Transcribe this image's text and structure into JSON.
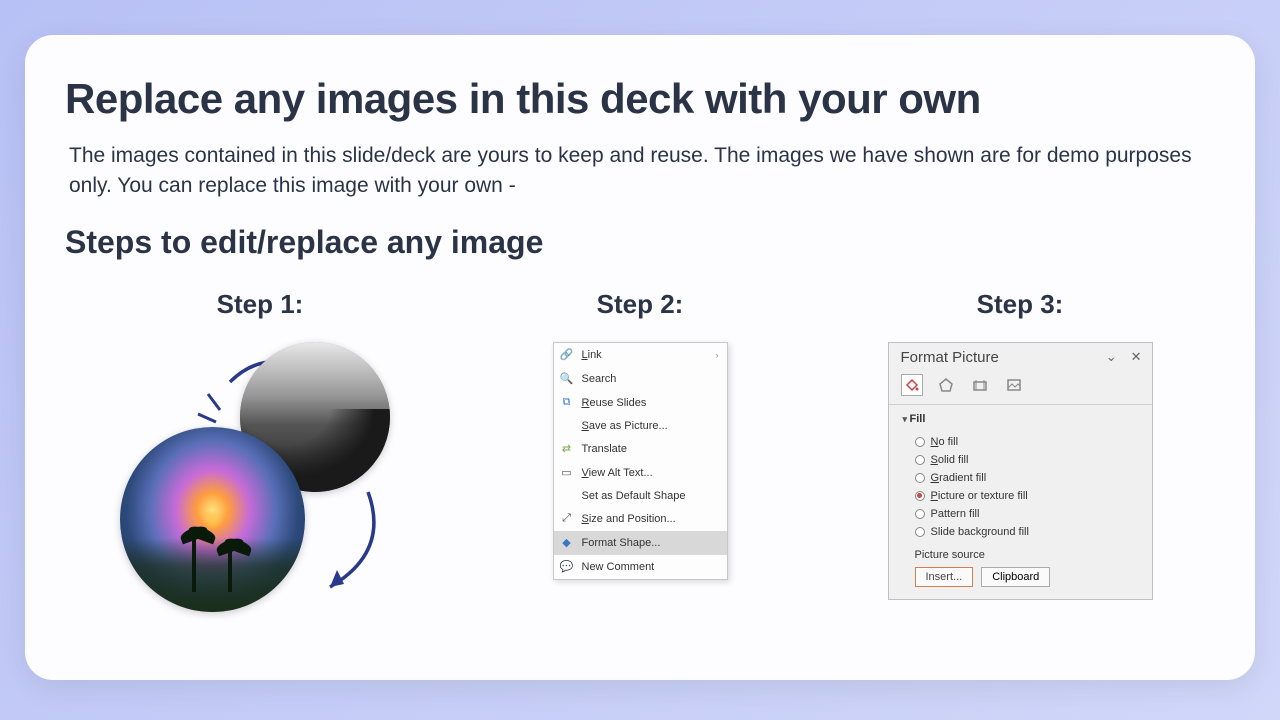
{
  "title": "Replace any images in this deck with your own",
  "description": "The images contained in this slide/deck are yours to keep and reuse. The images we have shown are for demo purposes only. You can replace this image with your own -",
  "subtitle": "Steps to edit/replace any image",
  "steps": {
    "step1": {
      "label": "Step 1:"
    },
    "step2": {
      "label": "Step 2:"
    },
    "step3": {
      "label": "Step 3:"
    }
  },
  "context_menu": {
    "items": [
      {
        "icon": "link",
        "label": "Link",
        "submenu": true
      },
      {
        "icon": "search",
        "label": "Search"
      },
      {
        "icon": "reuse",
        "label": "Reuse Slides"
      },
      {
        "icon": "",
        "label": "Save as Picture...",
        "indent": true
      },
      {
        "icon": "translate",
        "label": "Translate"
      },
      {
        "icon": "alttext",
        "label": "View Alt Text..."
      },
      {
        "icon": "",
        "label": "Set as Default Shape",
        "indent": true
      },
      {
        "icon": "size",
        "label": "Size and Position..."
      },
      {
        "icon": "format",
        "label": "Format Shape...",
        "selected": true
      },
      {
        "icon": "comment",
        "label": "New Comment"
      }
    ]
  },
  "format_panel": {
    "title": "Format Picture",
    "fill_label": "Fill",
    "options": [
      {
        "label": "No fill",
        "checked": false
      },
      {
        "label": "Solid fill",
        "checked": false
      },
      {
        "label": "Gradient fill",
        "checked": false
      },
      {
        "label": "Picture or texture fill",
        "checked": true
      },
      {
        "label": "Pattern fill",
        "checked": false
      },
      {
        "label": "Slide background fill",
        "checked": false
      }
    ],
    "picture_source_label": "Picture source",
    "insert_btn": "Insert...",
    "clipboard_btn": "Clipboard"
  }
}
